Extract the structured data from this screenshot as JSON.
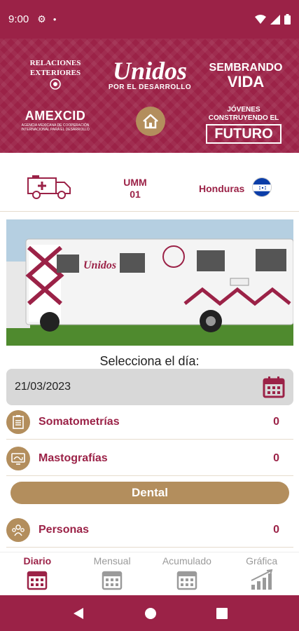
{
  "status_bar": {
    "time": "9:00",
    "gear_icon": "gear-icon",
    "wifi_icon": "wifi-icon",
    "signal_icon": "signal-icon",
    "battery_icon": "battery-icon"
  },
  "header": {
    "logos": {
      "sre": {
        "line1": "RELACIONES",
        "line2": "EXTERIORES"
      },
      "unidos": {
        "title": "Unidos",
        "subtitle": "POR EL DESARROLLO"
      },
      "sembrando": {
        "line1": "SEMBRANDO",
        "line2": "VIDA"
      },
      "amexcid": {
        "title": "AMEXCID",
        "subtitle": "AGENCIA MEXICANA DE COOPERACIÓN INTERNACIONAL PARA EL DESARROLLO"
      },
      "jovenes": {
        "line1": "JÓVENES",
        "line2": "CONSTRUYENDO EL",
        "line3": "FUTURO"
      }
    },
    "home_icon": "home-icon"
  },
  "info": {
    "unit_line1": "UMM",
    "unit_line2": "01",
    "country": "Honduras"
  },
  "day_label": "Selecciona el día:",
  "date_value": "21/03/2023",
  "rows": [
    {
      "label": "Somatometrías",
      "value": "0"
    },
    {
      "label": "Mastografías",
      "value": "0"
    }
  ],
  "dental_label": "Dental",
  "personas": {
    "label": "Personas",
    "value": "0"
  },
  "tabs": [
    {
      "label": "Diario"
    },
    {
      "label": "Mensual"
    },
    {
      "label": "Acumulado"
    },
    {
      "label": "Gráfica"
    }
  ],
  "colors": {
    "primary": "#9b2247",
    "accent": "#b38e5d"
  }
}
